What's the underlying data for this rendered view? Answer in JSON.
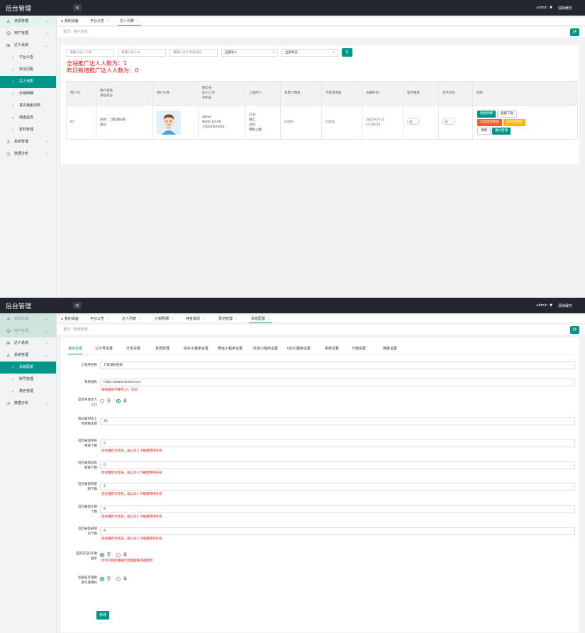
{
  "app_title": "后台管理",
  "topbar": {
    "user": "admin",
    "clear_cache": "清除缓存"
  },
  "shot1": {
    "sidebar": [
      {
        "label": "资源管理",
        "icon": "user-icon",
        "arrow": "‹",
        "style": "hl"
      },
      {
        "label": "用户管理",
        "icon": "smile-icon",
        "arrow": "‹",
        "style": ""
      },
      {
        "label": "达人系统",
        "icon": "grid-icon",
        "arrow": "⌄",
        "style": ""
      },
      {
        "label": "平台公告",
        "icon": "chevron-right-icon",
        "arrow": "",
        "style": "sub"
      },
      {
        "label": "常见问题",
        "icon": "chevron-right-icon",
        "arrow": "",
        "style": "sub"
      },
      {
        "label": "达人列表",
        "icon": "chevron-right-icon",
        "arrow": "",
        "style": "sub act"
      },
      {
        "label": "分销明细",
        "icon": "chevron-right-icon",
        "arrow": "",
        "style": "sub"
      },
      {
        "label": "真实佣金列表",
        "icon": "chevron-right-icon",
        "arrow": "",
        "style": "sub"
      },
      {
        "label": "佣金提现",
        "icon": "chevron-right-icon",
        "arrow": "",
        "style": "sub"
      },
      {
        "label": "素材管理",
        "icon": "chevron-right-icon",
        "arrow": "",
        "style": "sub"
      },
      {
        "label": "系统管理",
        "icon": "user-icon",
        "arrow": "‹",
        "style": ""
      },
      {
        "label": "数据分析",
        "icon": "clock-icon",
        "arrow": "‹",
        "style": ""
      }
    ],
    "tabs": [
      {
        "label": "我的桌面",
        "home": true,
        "active": false
      },
      {
        "label": "平台公告",
        "close": "×",
        "active": false
      },
      {
        "label": "达人列表",
        "close": "×",
        "active": true
      }
    ],
    "breadcrumb": "首页 / 用户信息",
    "filters": {
      "invite_code": "请输入达人口令",
      "user_id": "请输入达人id",
      "phone": "请输入达人手机号码",
      "level": "全部达人",
      "status": "全部状态"
    },
    "stats": {
      "total": "全站推广达人人数为：1",
      "yesterday": "昨日新增推广达人人数为：0"
    },
    "table": {
      "headers": [
        [
          "用户ID"
        ],
        [
          "用户昵称",
          "审核状态"
        ],
        [
          "用户头像"
        ],
        [
          "微信号",
          "达人口令",
          "手机号"
        ],
        [
          "上级用户"
        ],
        [
          "总累计佣金"
        ],
        [
          "可提现佣金"
        ],
        [
          "注册时间"
        ],
        [
          "是否推荐"
        ],
        [
          "是否封号"
        ],
        [
          "操作"
        ]
      ],
      "row": {
        "id": "67",
        "nick": "昵称：刀客源码网",
        "audit": "通过",
        "wechat": "dkewl",
        "code": "B606_DAAB",
        "phone": "15600000000",
        "parent": [
          "口令:",
          "微信",
          "号码:",
          "转移上级"
        ],
        "total": "0.000",
        "withdraw": "0.000",
        "reg_date": "2022-02-11",
        "reg_time": "11:28:53"
      },
      "actions": [
        {
          "label": "佣金明细",
          "style": "g"
        },
        {
          "label": "查看下级",
          "style": "w"
        },
        {
          "label": "冻结提现佣金",
          "style": "r"
        },
        {
          "label": "减积发佣金",
          "style": "o"
        },
        {
          "label": "详情",
          "style": "w"
        },
        {
          "label": "素材管理",
          "style": "g"
        }
      ]
    }
  },
  "shot2": {
    "sidebar": [
      {
        "label": "资源管理",
        "icon": "user-icon",
        "arrow": "‹",
        "style": "dim"
      },
      {
        "label": "用户管理",
        "icon": "smile-icon",
        "arrow": "‹",
        "style": "dim"
      },
      {
        "label": "达人系统",
        "icon": "grid-icon",
        "arrow": "‹",
        "style": ""
      },
      {
        "label": "系统管理",
        "icon": "user-icon",
        "arrow": "⌄",
        "style": ""
      },
      {
        "label": "系统配置",
        "icon": "chevron-right-icon",
        "arrow": "",
        "style": "sub act"
      },
      {
        "label": "账号管理",
        "icon": "chevron-right-icon",
        "arrow": "",
        "style": "sub"
      },
      {
        "label": "角色管理",
        "icon": "chevron-right-icon",
        "arrow": "",
        "style": "sub"
      },
      {
        "label": "数据分析",
        "icon": "clock-icon",
        "arrow": "‹",
        "style": ""
      }
    ],
    "tabs": [
      {
        "label": "我的桌面",
        "home": true,
        "active": false
      },
      {
        "label": "平台公告",
        "close": "×",
        "active": false
      },
      {
        "label": "达人列表",
        "close": "×",
        "active": false
      },
      {
        "label": "分销明细",
        "close": "×",
        "active": false
      },
      {
        "label": "佣金提现",
        "close": "×",
        "active": false
      },
      {
        "label": "素材管理",
        "close": "×",
        "active": false
      },
      {
        "label": "系统配置",
        "close": "×",
        "active": true
      }
    ],
    "breadcrumb": "首页 / 系统配置",
    "config_tabs": [
      "基础设置",
      "公众号设置",
      "分享设置",
      "资源管理",
      "快手小程序设置",
      "微信小程序设置",
      "抖音小程序设置",
      "QQ小程序设置",
      "系统设置",
      "分销设置",
      "佣金设置"
    ],
    "form": [
      {
        "label": [
          "小程序名称"
        ],
        "type": "input",
        "value": "刀客源码壁纸"
      },
      {
        "label": [
          "系统域名"
        ],
        "type": "input",
        "value": "https://www.dkewl.com",
        "hint": "域名最后不要带上/，切记"
      },
      {
        "label": [
          "是否开放达人",
          "入口"
        ],
        "type": "radio",
        "options": [
          "否",
          "是"
        ],
        "selected": 1
      },
      {
        "label": [
          "每日素材也上",
          "传限制次数"
        ],
        "type": "input",
        "value": "20"
      },
      {
        "label": [
          "首页展现手机",
          "壁纸个数"
        ],
        "type": "input",
        "value": "5",
        "hint": "后台推荐为优先，再以达人下载量倒序补充"
      },
      {
        "label": [
          "首页展现动态",
          "壁纸个数"
        ],
        "type": "input",
        "value": "0",
        "hint": "后台推荐为优先，再以达人下载量倒序补充"
      },
      {
        "label": [
          "首页展现背景",
          "图个数"
        ],
        "type": "input",
        "value": "2",
        "hint": "后台推荐为优先，再以达人下载量倒序补充"
      },
      {
        "label": [
          "首页展现头像",
          "个数"
        ],
        "type": "input",
        "value": "9",
        "hint": "后台推荐为优先，再以达人下载量倒序补充"
      },
      {
        "label": [
          "首页展现表情",
          "包个数"
        ],
        "type": "input",
        "value": "9",
        "hint": "后台推荐为优先，再以达人下载量倒序补充"
      },
      {
        "label": [
          "是否开启GIF图",
          "展示"
        ],
        "type": "radio",
        "options": [
          "否",
          "是"
        ],
        "selected": 0,
        "hint": "针对小程序端展示动图面静态图使用"
      },
      {
        "label": [
          "注册是否强制",
          "填写邀请码"
        ],
        "type": "radio",
        "options": [
          "否",
          "是"
        ],
        "selected": 0
      }
    ],
    "submit": "修改"
  },
  "colors": {
    "accent": "#009688",
    "topbar": "#23262e",
    "danger": "#ff5722",
    "warn": "#ffb800"
  }
}
